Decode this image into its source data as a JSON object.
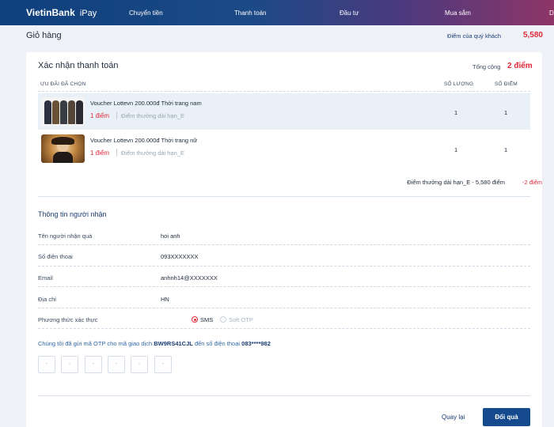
{
  "brand": {
    "name": "VietinBank",
    "product": "iPay"
  },
  "nav": [
    "Chuyển tiền",
    "Thanh toán",
    "Đầu tư",
    "Mua sắm",
    "D"
  ],
  "page": {
    "title": "Giỏ hàng",
    "points_label": "Điểm của quý khách",
    "points_value": "5,580"
  },
  "checkout": {
    "title": "Xác nhận thanh toán",
    "total_label": "Tổng cộng",
    "total_value": "2 điểm",
    "columns": {
      "offer": "ƯU ĐÃI ĐÃ CHỌN",
      "qty": "SỐ LƯỢNG",
      "points": "SỐ ĐIỂM"
    },
    "items": [
      {
        "name": "Voucher Lottevn 200.000đ Thời trang nam",
        "points": "1 điểm",
        "category": "Điểm thưởng dài hạn_E",
        "qty": "1",
        "score": "1"
      },
      {
        "name": "Voucher Lottevn 200.000đ Thời trang nữ",
        "points": "1 điểm",
        "category": "Điểm thưởng dài hạn_E",
        "qty": "1",
        "score": "1"
      }
    ],
    "summary_text": "Điểm thưởng dài hạn_E - 5,580 điểm",
    "summary_value": "-2 điểm"
  },
  "recipient": {
    "title": "Thông tin người nhận",
    "name_label": "Tên người nhận quà",
    "name_value": "hoi anh",
    "phone_label": "Số điện thoại",
    "phone_value": "093XXXXXXX",
    "email_label": "Email",
    "email_value": "anhnh14@XXXXXXX",
    "address_label": "Địa chỉ",
    "address_value": "HN",
    "method_label": "Phương thức xác thực",
    "method_sms": "SMS",
    "method_softotp": "Soft OTP"
  },
  "otp": {
    "msg_prefix": "Chúng tôi đã gửi mã OTP cho mã giao dịch",
    "txn_code": "BW9RS41CJL",
    "msg_mid": "đến số điện thoại",
    "phone": "083****982",
    "placeholder": "-"
  },
  "actions": {
    "back": "Quay lại",
    "confirm": "Đổi quà"
  },
  "colors": {
    "primary": "#164a8e",
    "accent": "#e0293a",
    "nav_gradient_start": "#0f3f7c",
    "nav_gradient_end": "#8e3568"
  }
}
